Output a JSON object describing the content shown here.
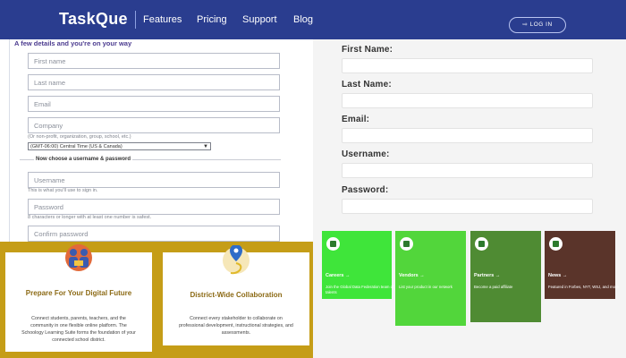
{
  "nav": {
    "logo_text": "TaskQue",
    "links": [
      "Features",
      "Pricing",
      "Support",
      "Blog"
    ],
    "login_label": "LOG IN"
  },
  "form": {
    "heading": "A few details and you're on your way",
    "first_name_placeholder": "First name",
    "last_name_placeholder": "Last name",
    "email_placeholder": "Email",
    "company_placeholder": "Company",
    "company_hint": "(Or non-profit, organization, group, school, etc.)",
    "timezone_value": "(GMT-06:00) Central Time (US & Canada)",
    "section_label": "Now choose a username & password",
    "username_placeholder": "Username",
    "username_hint": "This is what you'll use to sign in.",
    "password_placeholder": "Password",
    "password_hint": "8 characters or longer with at least one number is safest.",
    "confirm_placeholder": "Confirm password"
  },
  "cards": [
    {
      "title": "Prepare For Your Digital Future",
      "desc": "Connect students, parents, teachers, and the community in one flexible online platform. The Schoology Learning Suite forms the foundation of your connected school district.",
      "icon": "people-icon"
    },
    {
      "title": "District-Wide Collaboration",
      "desc": "Connect every stakeholder to collaborate on professional development, instructional strategies, and assessments.",
      "icon": "location-pin-icon"
    }
  ],
  "right_form": {
    "labels": [
      "First Name:",
      "Last Name:",
      "Email:",
      "Username:",
      "Password:"
    ]
  },
  "tiles": [
    {
      "title": "Careers →",
      "desc": "Join the Global Data Federation team of talents",
      "color": "#3fe53a"
    },
    {
      "title": "Vendors →",
      "desc": "List your product in our network",
      "color": "#52d63b"
    },
    {
      "title": "Partners →",
      "desc": "Become a paid affiliate",
      "color": "#4f8b33"
    },
    {
      "title": "News →",
      "desc": "Featured in Forbes, NYT, WSJ, and more",
      "color": "#5a342a"
    }
  ],
  "colors": {
    "nav_bg": "#2a3d8f",
    "gold_bg": "#c59d17",
    "card_title": "#8c6a15"
  }
}
